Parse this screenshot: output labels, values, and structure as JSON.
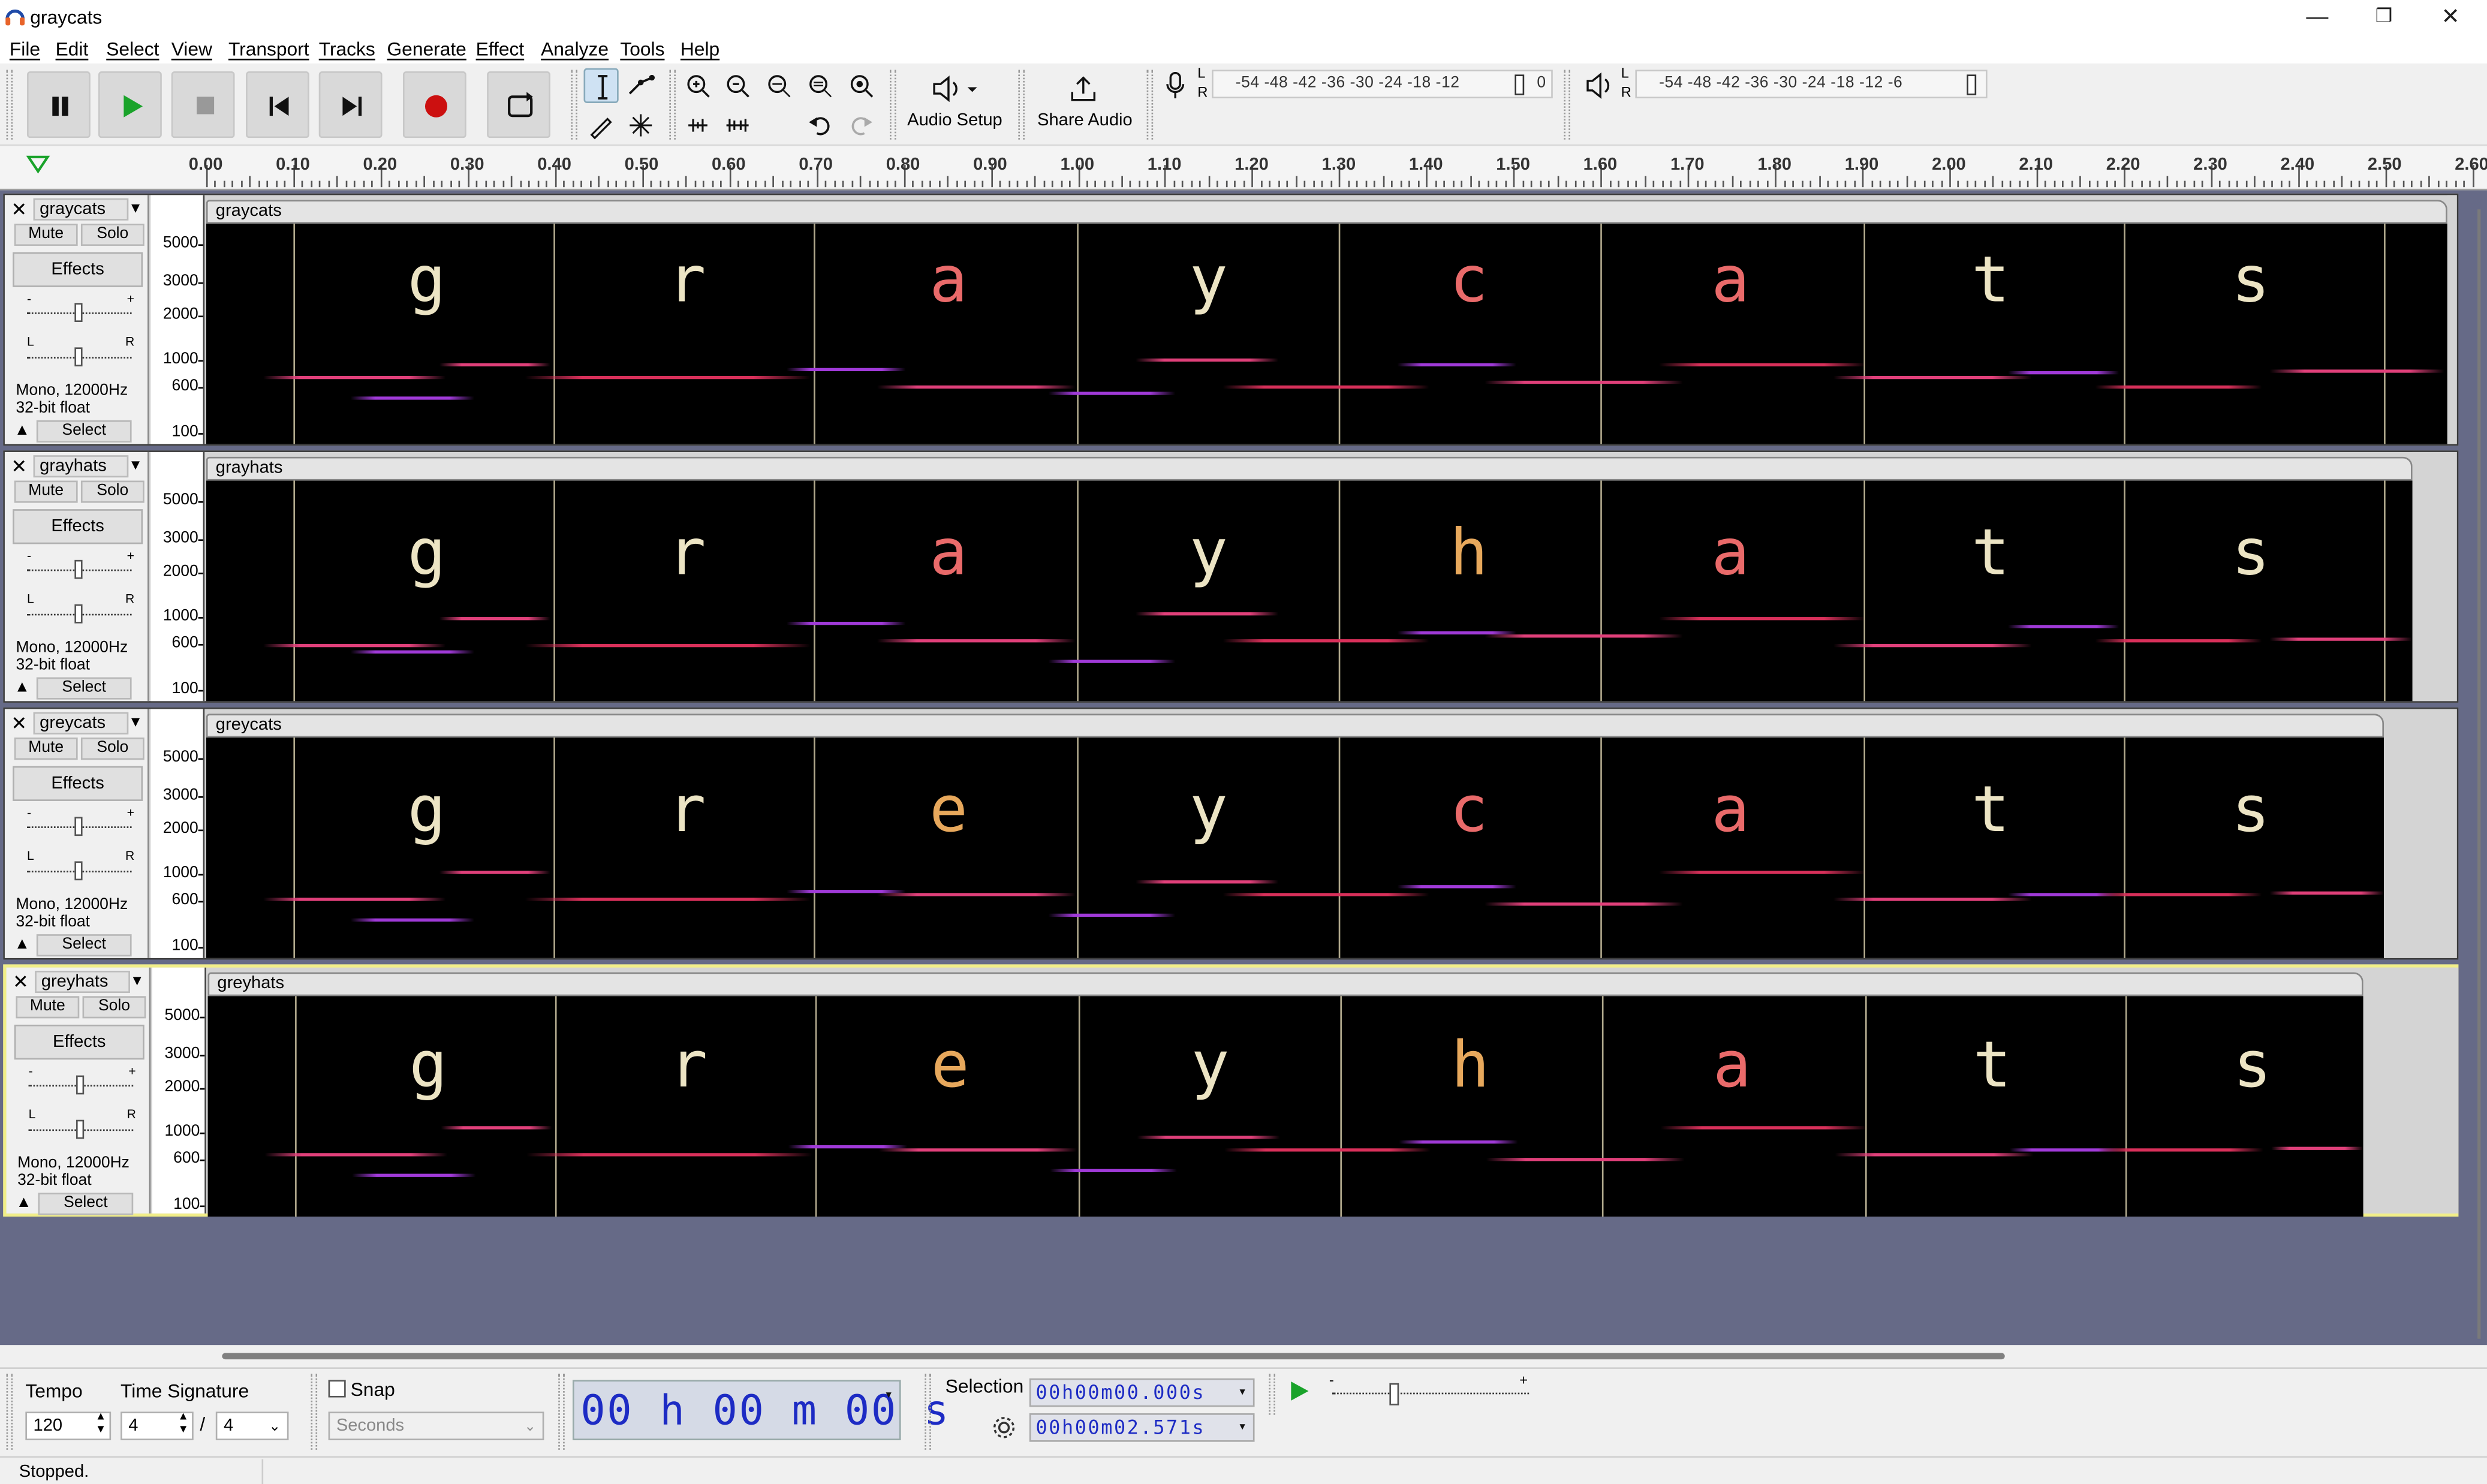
{
  "window": {
    "title": "graycats",
    "controls": [
      "—",
      "❐",
      "✕"
    ]
  },
  "menu": [
    "File",
    "Edit",
    "Select",
    "View",
    "Transport",
    "Tracks",
    "Generate",
    "Effect",
    "Analyze",
    "Tools",
    "Help"
  ],
  "toolbar": {
    "audio_setup_label": "Audio Setup",
    "share_audio_label": "Share Audio",
    "record_meter_scale": "-54 -48 -42 -36 -30 -24 -18 -12",
    "record_meter_end": "0",
    "playback_meter_scale": "-54 -48 -42 -36 -30 -24 -18 -12 -6",
    "meter_lr": [
      "L",
      "R"
    ]
  },
  "ruler": {
    "labels": [
      "0.00",
      "0.10",
      "0.20",
      "0.30",
      "0.40",
      "0.50",
      "0.60",
      "0.70",
      "0.80",
      "0.90",
      "1.00",
      "1.10",
      "1.20",
      "1.30",
      "1.40",
      "1.50",
      "1.60",
      "1.70",
      "1.80",
      "1.90",
      "2.00",
      "2.10",
      "2.20",
      "2.30",
      "2.40",
      "2.50",
      "2.60"
    ]
  },
  "tracks": [
    {
      "name": "graycats",
      "clip_name": "graycats",
      "mute": "Mute",
      "solo": "Solo",
      "effects": "Effects",
      "info_line1": "Mono, 12000Hz",
      "info_line2": "32-bit float",
      "select": "Select",
      "selected": false,
      "letters": [
        "g",
        "r",
        "a",
        "y",
        "c",
        "a",
        "t",
        "s"
      ]
    },
    {
      "name": "grayhats",
      "clip_name": "grayhats",
      "mute": "Mute",
      "solo": "Solo",
      "effects": "Effects",
      "info_line1": "Mono, 12000Hz",
      "info_line2": "32-bit float",
      "select": "Select",
      "selected": false,
      "letters": [
        "g",
        "r",
        "a",
        "y",
        "h",
        "a",
        "t",
        "s"
      ]
    },
    {
      "name": "greycats",
      "clip_name": "greycats",
      "mute": "Mute",
      "solo": "Solo",
      "effects": "Effects",
      "info_line1": "Mono, 12000Hz",
      "info_line2": "32-bit float",
      "select": "Select",
      "selected": false,
      "letters": [
        "g",
        "r",
        "e",
        "y",
        "c",
        "a",
        "t",
        "s"
      ]
    },
    {
      "name": "greyhats",
      "clip_name": "greyhats",
      "mute": "Mute",
      "solo": "Solo",
      "effects": "Effects",
      "info_line1": "Mono, 12000Hz",
      "info_line2": "32-bit float",
      "select": "Select",
      "selected": true,
      "letters": [
        "g",
        "r",
        "e",
        "y",
        "h",
        "a",
        "t",
        "s"
      ]
    }
  ],
  "track_scale": [
    "5000",
    "3000",
    "2000",
    "1000",
    "600",
    "100"
  ],
  "letter_colors": {
    "a": "#e96a6a",
    "c": "#e96a6a",
    "e": "#e7a85c",
    "h": "#e7a85c",
    "default": "#ece4c4"
  },
  "streak_colors": [
    "#e0407a",
    "#a03ad8",
    "#d8305a"
  ],
  "bottom": {
    "tempo_label": "Tempo",
    "tempo_value": "120",
    "time_signature_label": "Time Signature",
    "ts_numerator": "4",
    "ts_separator": "/",
    "ts_denominator": "4",
    "snap_label": "Snap",
    "snap_unit": "Seconds",
    "time_display": "00 h 00 m 00 s",
    "selection_label": "Selection",
    "selection_start": "00h00m00.000s",
    "selection_end": "00h00m02.571s"
  },
  "status": {
    "text": "Stopped."
  }
}
